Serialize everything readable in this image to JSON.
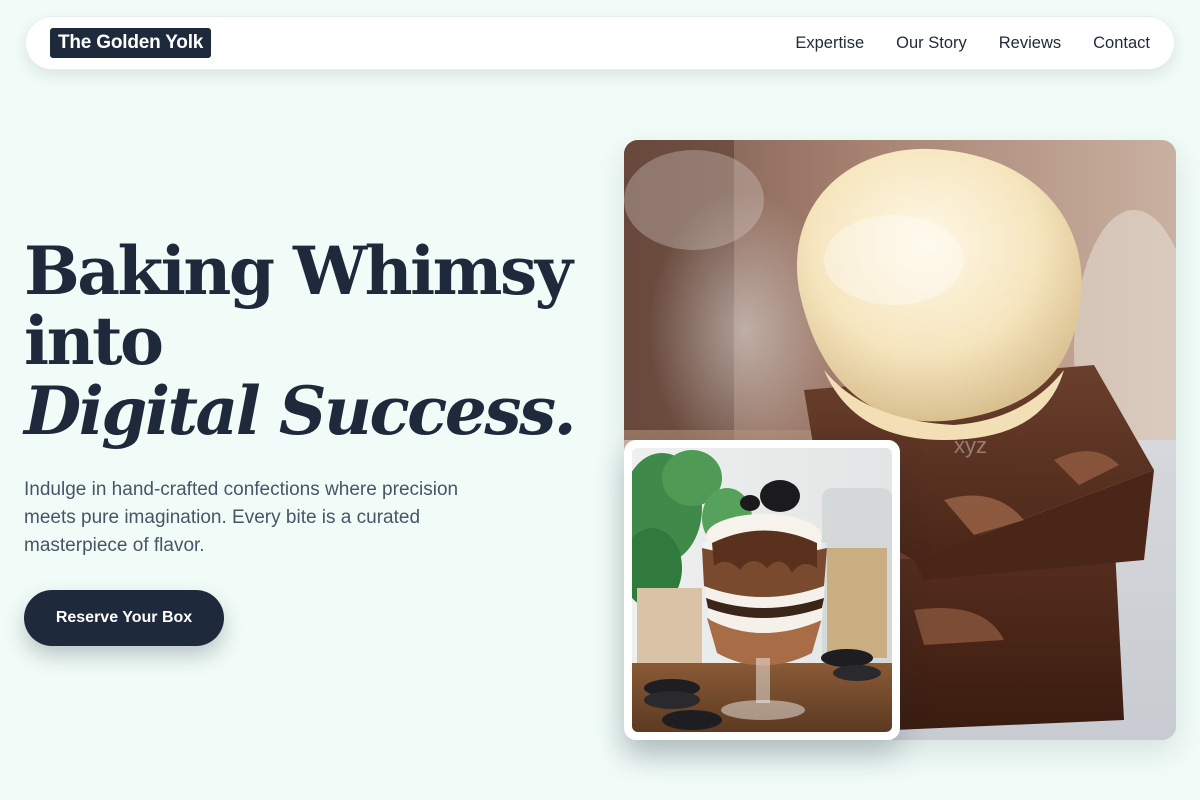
{
  "brand": {
    "name": "The Golden Yolk"
  },
  "nav": {
    "links": [
      {
        "label": "Expertise"
      },
      {
        "label": "Our Story"
      },
      {
        "label": "Reviews"
      },
      {
        "label": "Contact"
      }
    ]
  },
  "hero": {
    "title_line1": "Baking Whimsy",
    "title_line2": "into",
    "title_line3": "Digital Success.",
    "description": "Indulge in hand-crafted confections where precision meets pure imagination. Every bite is a curated masterpiece of flavor.",
    "cta_label": "Reserve Your Box"
  },
  "images": {
    "main": {
      "subject": "vanilla ice cream scoop on stacked chocolate brownies",
      "watermark": "xyz"
    },
    "inset": {
      "subject": "chocolate cookie parfait in a glass with oreo cookies"
    }
  },
  "colors": {
    "background": "#f1fcf8",
    "primary": "#1e293b",
    "text_muted": "#475569",
    "surface": "#ffffff"
  }
}
